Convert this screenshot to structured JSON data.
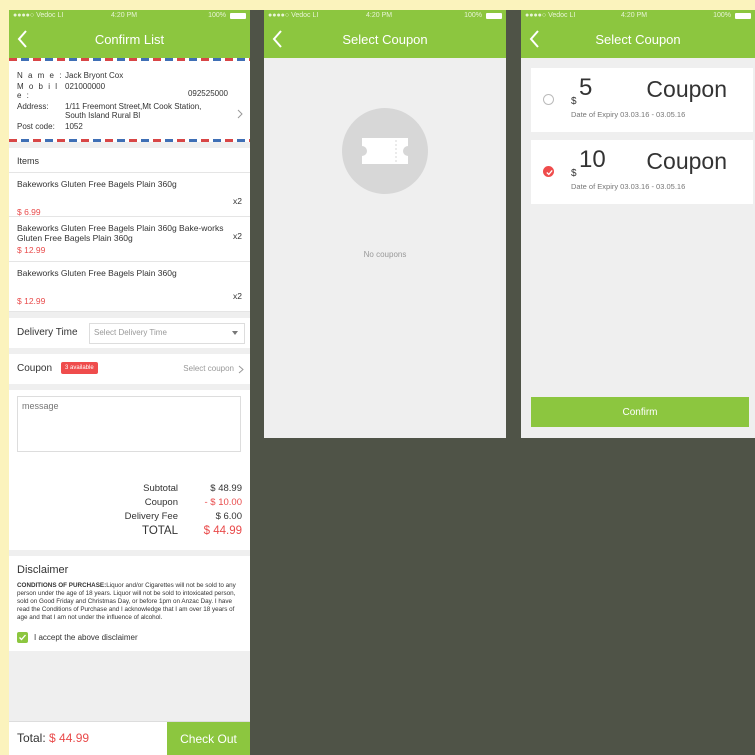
{
  "status_bar": {
    "carrier": "Vedoc LI",
    "time": "4:20 PM",
    "battery": "100%"
  },
  "confirm_screen": {
    "title": "Confirm List",
    "address": {
      "name_label": "N a m e :",
      "name": "Jack Bryont Cox",
      "mobile_label": "M o b i l e :",
      "mobile": "021000000",
      "mobile2": "092525000",
      "address_label": "Address:",
      "address_line1": "1/11 Freemont Street,Mt Cook Station,",
      "address_line2": "South Island Rural Bl",
      "post_label": "Post code:",
      "post_code": "1052"
    },
    "items_heading": "Items",
    "items": [
      {
        "name": "Bakeworks Gluten Free Bagels Plain 360g",
        "price": "$ 6.99",
        "qty": "x2"
      },
      {
        "name": "Bakeworks Gluten Free Bagels Plain 360g Bake-works Gluten Free Bagels Plain 360g",
        "price": "$ 12.99",
        "qty": "x2"
      },
      {
        "name": "Bakeworks Gluten Free Bagels Plain 360g",
        "price": "$ 12.99",
        "qty": "x2"
      }
    ],
    "delivery_label": "Delivery Time",
    "delivery_placeholder": "Select Delivery Time",
    "coupon_label": "Coupon",
    "coupon_badge": "3 available",
    "coupon_select": "Select coupon",
    "message_placeholder": "message",
    "totals": {
      "subtotal_label": "Subtotal",
      "subtotal": "$ 48.99",
      "coupon_label": "Coupon",
      "coupon": "- $ 10.00",
      "delivery_label": "Delivery Fee",
      "delivery": "$ 6.00",
      "total_label": "TOTAL",
      "total": "$ 44.99"
    },
    "disclaimer": {
      "heading": "Disclaimer",
      "strong": "CONDITIONS OF PURCHASE:",
      "text": "Liquor and/or Cigarettes will not be sold to any person under the age of 18 years. Liquor will not be sold to intoxicated person, sold on Good Friday and Christmas Day, or before 1pm on Anzac Day. I have read the Conditions of Purchase and I acknowledge that I am over 18 years of age and that I am not under the influence of alcohol.",
      "accept": "I accept the above disclaimer"
    },
    "bottom": {
      "total_label": "Total:",
      "total": "$ 44.99",
      "checkout": "Check Out"
    }
  },
  "empty_coupon_screen": {
    "title": "Select Coupon",
    "empty_text": "No coupons"
  },
  "coupon_screen": {
    "title": "Select Coupon",
    "coupons": [
      {
        "currency": "$",
        "amount": "5",
        "word": "Coupon",
        "expiry": "Date of Expiry  03.03.16 - 03.05.16",
        "selected": false
      },
      {
        "currency": "$",
        "amount": "10",
        "word": "Coupon",
        "expiry": "Date of Expiry  03.03.16 - 03.05.16",
        "selected": true
      }
    ],
    "confirm": "Confirm"
  },
  "colors": {
    "accent": "#8cc63f",
    "price_red": "#e94b4b",
    "background": "#4f5347",
    "gold_border": "#fbf3bd"
  }
}
